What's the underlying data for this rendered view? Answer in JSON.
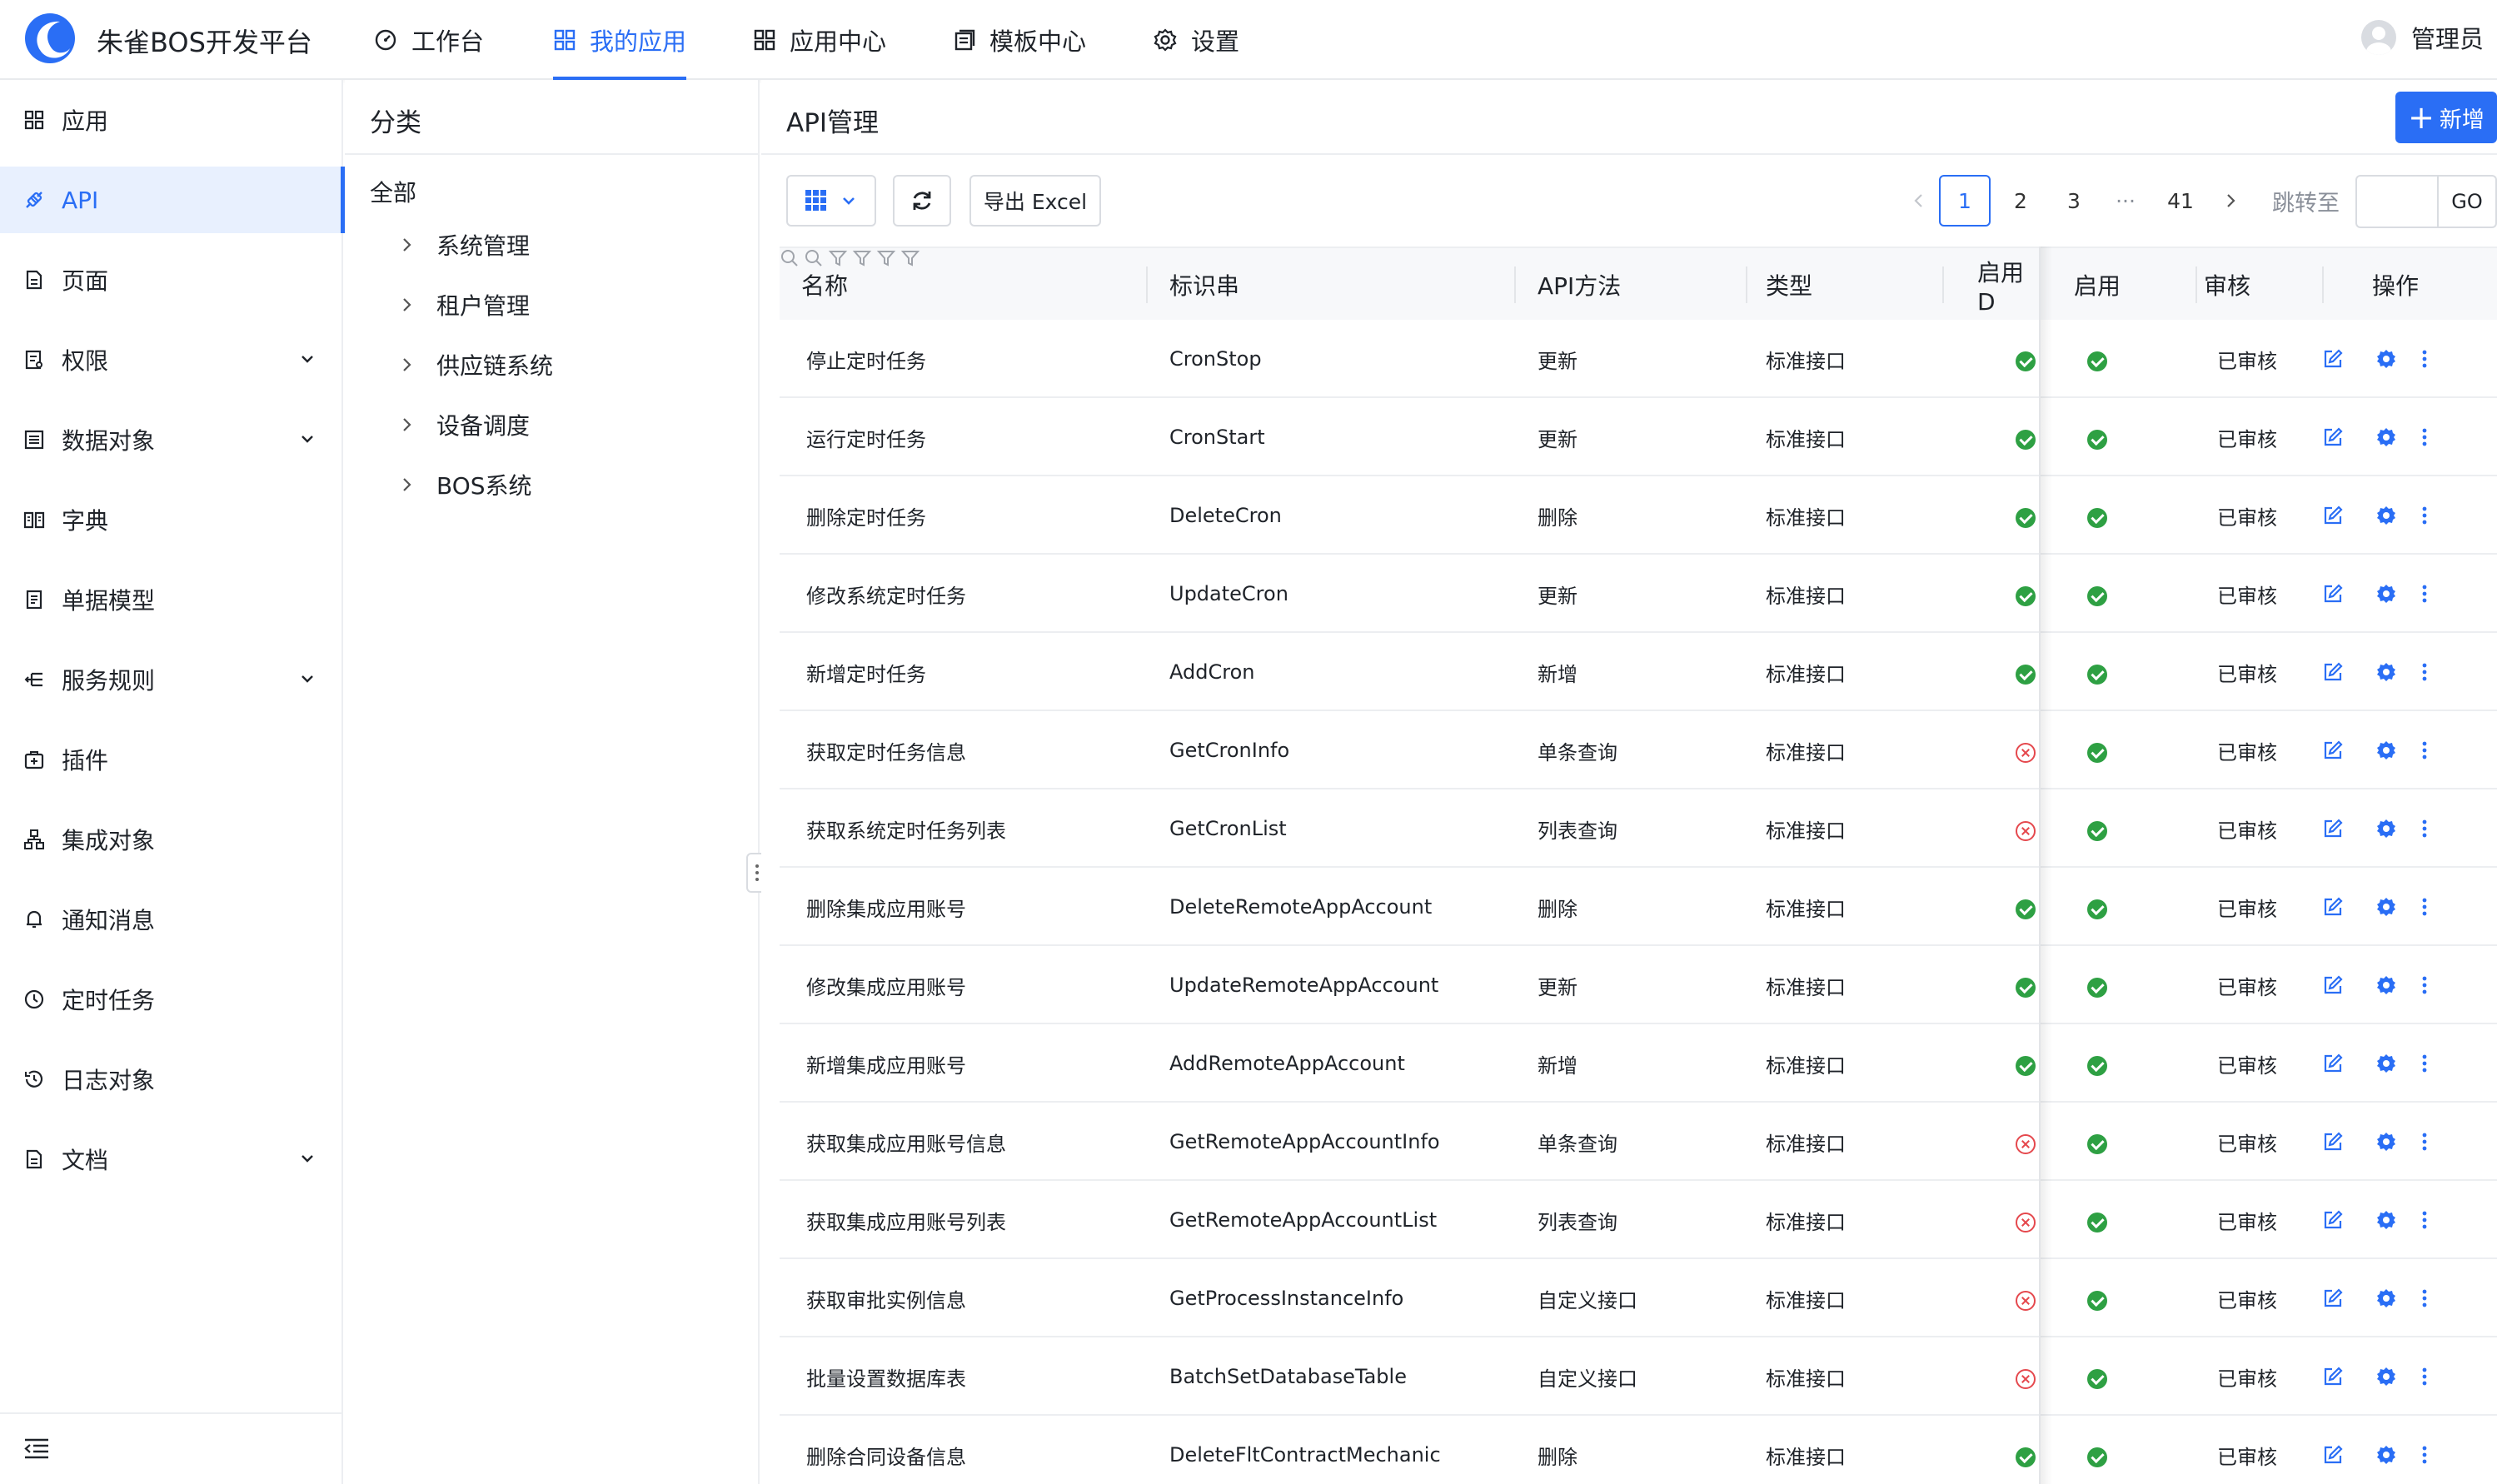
{
  "app": {
    "title": "朱雀BOS开发平台",
    "user": "管理员"
  },
  "nav": [
    {
      "label": "工作台",
      "icon": "dashboard-icon",
      "active": false
    },
    {
      "label": "我的应用",
      "icon": "apps-icon",
      "active": true
    },
    {
      "label": "应用中心",
      "icon": "grid-icon",
      "active": false
    },
    {
      "label": "模板中心",
      "icon": "template-icon",
      "active": false
    },
    {
      "label": "设置",
      "icon": "gear-icon",
      "active": false
    }
  ],
  "sidebar": [
    {
      "label": "应用",
      "icon": "grid-icon",
      "expandable": false,
      "active": false
    },
    {
      "label": "API",
      "icon": "api-icon",
      "expandable": false,
      "active": true
    },
    {
      "label": "页面",
      "icon": "page-icon",
      "expandable": false,
      "active": false
    },
    {
      "label": "权限",
      "icon": "permission-icon",
      "expandable": true,
      "active": false
    },
    {
      "label": "数据对象",
      "icon": "data-object-icon",
      "expandable": true,
      "active": false
    },
    {
      "label": "字典",
      "icon": "dictionary-icon",
      "expandable": false,
      "active": false
    },
    {
      "label": "单据模型",
      "icon": "document-model-icon",
      "expandable": false,
      "active": false
    },
    {
      "label": "服务规则",
      "icon": "rule-icon",
      "expandable": true,
      "active": false
    },
    {
      "label": "插件",
      "icon": "plugin-icon",
      "expandable": false,
      "active": false
    },
    {
      "label": "集成对象",
      "icon": "integration-icon",
      "expandable": false,
      "active": false
    },
    {
      "label": "通知消息",
      "icon": "bell-icon",
      "expandable": false,
      "active": false
    },
    {
      "label": "定时任务",
      "icon": "clock-icon",
      "expandable": false,
      "active": false
    },
    {
      "label": "日志对象",
      "icon": "log-icon",
      "expandable": false,
      "active": false
    },
    {
      "label": "文档",
      "icon": "doc-icon",
      "expandable": true,
      "active": false
    }
  ],
  "category": {
    "title": "分类",
    "root": "全部",
    "nodes": [
      "系统管理",
      "租户管理",
      "供应链系统",
      "设备调度",
      "BOS系统"
    ]
  },
  "main": {
    "title": "API管理",
    "add_label": "新增",
    "export_label": "导出 Excel",
    "pagination": {
      "pages": [
        "1",
        "2",
        "3",
        "···",
        "41"
      ],
      "current": "1",
      "jump_label": "跳转至",
      "go_label": "GO"
    }
  },
  "table": {
    "columns": [
      "名称",
      "标识串",
      "API方法",
      "类型",
      "启用D",
      "启用",
      "审核",
      "操作"
    ],
    "rows": [
      {
        "name": "停止定时任务",
        "code": "CronStop",
        "method": "更新",
        "type": "标准接口",
        "enabled_d": true,
        "enabled": true,
        "audit": "已审核"
      },
      {
        "name": "运行定时任务",
        "code": "CronStart",
        "method": "更新",
        "type": "标准接口",
        "enabled_d": true,
        "enabled": true,
        "audit": "已审核"
      },
      {
        "name": "删除定时任务",
        "code": "DeleteCron",
        "method": "删除",
        "type": "标准接口",
        "enabled_d": true,
        "enabled": true,
        "audit": "已审核"
      },
      {
        "name": "修改系统定时任务",
        "code": "UpdateCron",
        "method": "更新",
        "type": "标准接口",
        "enabled_d": true,
        "enabled": true,
        "audit": "已审核"
      },
      {
        "name": "新增定时任务",
        "code": "AddCron",
        "method": "新增",
        "type": "标准接口",
        "enabled_d": true,
        "enabled": true,
        "audit": "已审核"
      },
      {
        "name": "获取定时任务信息",
        "code": "GetCronInfo",
        "method": "单条查询",
        "type": "标准接口",
        "enabled_d": false,
        "enabled": true,
        "audit": "已审核"
      },
      {
        "name": "获取系统定时任务列表",
        "code": "GetCronList",
        "method": "列表查询",
        "type": "标准接口",
        "enabled_d": false,
        "enabled": true,
        "audit": "已审核"
      },
      {
        "name": "删除集成应用账号",
        "code": "DeleteRemoteAppAccount",
        "method": "删除",
        "type": "标准接口",
        "enabled_d": true,
        "enabled": true,
        "audit": "已审核"
      },
      {
        "name": "修改集成应用账号",
        "code": "UpdateRemoteAppAccount",
        "method": "更新",
        "type": "标准接口",
        "enabled_d": true,
        "enabled": true,
        "audit": "已审核"
      },
      {
        "name": "新增集成应用账号",
        "code": "AddRemoteAppAccount",
        "method": "新增",
        "type": "标准接口",
        "enabled_d": true,
        "enabled": true,
        "audit": "已审核"
      },
      {
        "name": "获取集成应用账号信息",
        "code": "GetRemoteAppAccountInfo",
        "method": "单条查询",
        "type": "标准接口",
        "enabled_d": false,
        "enabled": true,
        "audit": "已审核"
      },
      {
        "name": "获取集成应用账号列表",
        "code": "GetRemoteAppAccountList",
        "method": "列表查询",
        "type": "标准接口",
        "enabled_d": false,
        "enabled": true,
        "audit": "已审核"
      },
      {
        "name": "获取审批实例信息",
        "code": "GetProcessInstanceInfo",
        "method": "自定义接口",
        "type": "标准接口",
        "enabled_d": false,
        "enabled": true,
        "audit": "已审核"
      },
      {
        "name": "批量设置数据库表",
        "code": "BatchSetDatabaseTable",
        "method": "自定义接口",
        "type": "标准接口",
        "enabled_d": false,
        "enabled": true,
        "audit": "已审核"
      },
      {
        "name": "删除合同设备信息",
        "code": "DeleteFltContractMechanic",
        "method": "删除",
        "type": "标准接口",
        "enabled_d": true,
        "enabled": true,
        "audit": "已审核"
      }
    ]
  },
  "colors": {
    "primary": "#2a6ef5",
    "success": "#2ea043",
    "danger": "#e5484d"
  }
}
